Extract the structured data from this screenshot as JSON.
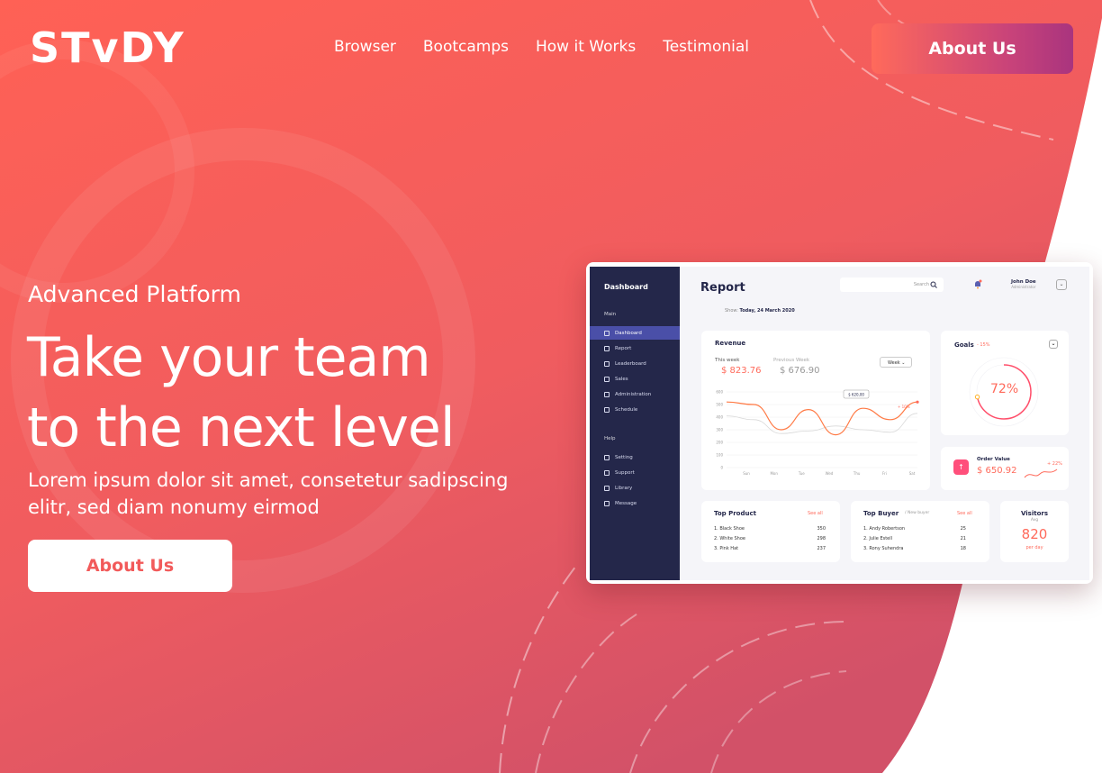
{
  "brand": {
    "logo": "STvDY"
  },
  "nav": {
    "items": [
      "Browser",
      "Bootcamps",
      "How it Works",
      "Testimonial"
    ],
    "cta": "About Us"
  },
  "hero": {
    "eyebrow": "Advanced Platform",
    "headline_line1": "Take your team",
    "headline_line2": "to the next level",
    "lead": "Lorem ipsum dolor sit amet, consetetur sadipscing elitr, sed diam nonumy eirmod",
    "cta": "About Us"
  },
  "colors": {
    "gradient_start": "#ff6a5b",
    "gradient_end": "#d4506a",
    "accent": "#ff6a5b",
    "sidebar": "#24274a"
  },
  "dashboard": {
    "sidebar": {
      "title": "Dashboard",
      "main_label": "Main",
      "main_items": [
        "Dashboard",
        "Report",
        "Leaderboard",
        "Sales",
        "Administration",
        "Schedule"
      ],
      "help_label": "Help",
      "help_items": [
        "Setting",
        "Support",
        "Library",
        "Message"
      ]
    },
    "title": "Report",
    "search_placeholder": "Search",
    "user_name": "John Doe",
    "user_role": "Administrator",
    "show_label": "Show:",
    "show_value": "Today, 24 March 2020",
    "revenue": {
      "title": "Revenue",
      "this_week_label": "This week",
      "this_week_value": "$ 823.76",
      "prev_week_label": "Previous Week",
      "prev_week_value": "$ 676.90",
      "period": "Week",
      "tooltip": "$ 620,00",
      "change": "+ 10%"
    },
    "goals": {
      "title": "Goals",
      "change": "- 15%",
      "percent": "72%",
      "value": 0.72
    },
    "order_value": {
      "title": "Order Value",
      "value": "$ 650.92",
      "change": "+ 22%"
    },
    "top_product": {
      "title": "Top Product",
      "link": "See all",
      "rows": [
        {
          "label": "1. Black Shoe",
          "value": "350"
        },
        {
          "label": "2. White Shoe",
          "value": "298"
        },
        {
          "label": "3. Pink Hat",
          "value": "237"
        }
      ]
    },
    "top_buyer": {
      "title": "Top Buyer",
      "subtitle": "/ New buyer",
      "link": "See all",
      "rows": [
        {
          "label": "1. Andy Robertson",
          "value": "25"
        },
        {
          "label": "2. Julie Estell",
          "value": "21"
        },
        {
          "label": "3. Rony Suhendra",
          "value": "18"
        }
      ]
    },
    "visitors": {
      "title": "Visitors",
      "subtitle": "Avg",
      "value": "820",
      "period": "per day"
    }
  },
  "chart_data": {
    "type": "line",
    "categories": [
      "Sun",
      "Mon",
      "Tue",
      "Wed",
      "Thu",
      "Fri",
      "Sat"
    ],
    "y_ticks": [
      "0",
      "100",
      "200",
      "300",
      "400",
      "500",
      "600"
    ],
    "ylim": [
      0,
      600
    ],
    "series": [
      {
        "values": [
          520,
          500,
          300,
          460,
          260,
          470,
          380,
          520
        ]
      },
      {
        "values": [
          410,
          380,
          270,
          290,
          330,
          300,
          280,
          430
        ]
      }
    ]
  }
}
